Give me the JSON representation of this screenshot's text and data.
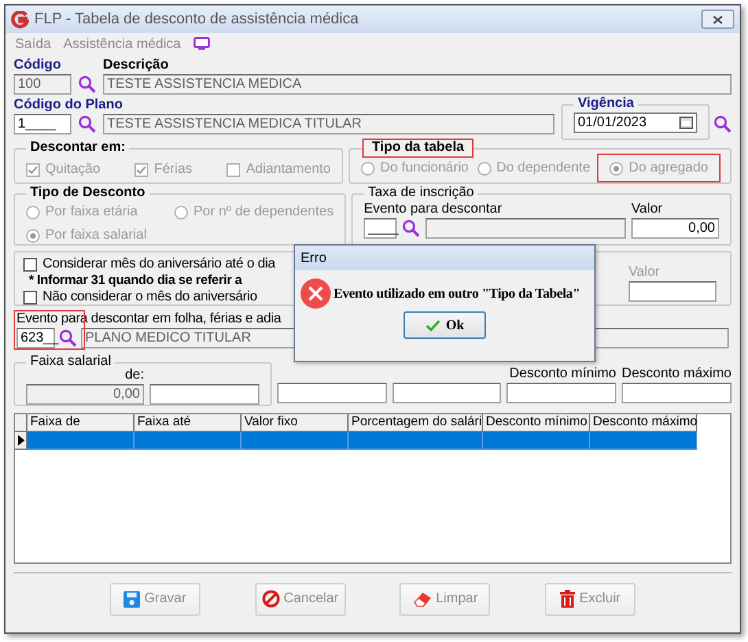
{
  "window": {
    "title": "FLP - Tabela de desconto de assistência médica"
  },
  "menu": [
    {
      "label": "Saída"
    },
    {
      "label": "Assistência médica"
    }
  ],
  "codigo": {
    "label": "Código",
    "value": "100"
  },
  "descricao": {
    "label": "Descrição",
    "value": "TESTE ASSISTENCIA MEDICA"
  },
  "codigo_plano": {
    "label": "Código do Plano",
    "value": "1____",
    "description": "TESTE ASSISTENCIA MEDICA TITULAR"
  },
  "vigencia": {
    "label": "Vigência",
    "value": "01/01/2023"
  },
  "descontar_em": {
    "title": "Descontar em:",
    "options": [
      {
        "label": "Quitação",
        "checked": true,
        "disabled": true
      },
      {
        "label": "Férias",
        "checked": true,
        "disabled": true
      },
      {
        "label": "Adiantamento",
        "checked": false,
        "disabled": true
      }
    ]
  },
  "tipo_tabela": {
    "title": "Tipo da tabela",
    "highlighted": true,
    "options": [
      {
        "label": "Do funcionário",
        "selected": false,
        "disabled": true,
        "highlighted": false
      },
      {
        "label": "Do dependente",
        "selected": false,
        "disabled": true,
        "highlighted": false
      },
      {
        "label": "Do agregado",
        "selected": true,
        "disabled": true,
        "highlighted": true
      }
    ]
  },
  "tipo_desconto": {
    "title": "Tipo de Desconto",
    "options": [
      {
        "label": "Por faixa etária",
        "selected": false,
        "disabled": true
      },
      {
        "label": "Por nº de dependentes",
        "selected": false,
        "disabled": true
      },
      {
        "label": "Por faixa salarial",
        "selected": true,
        "disabled": true
      }
    ]
  },
  "taxa_inscricao": {
    "title": "Taxa de inscrição",
    "evento_label": "Evento para descontar",
    "evento_value": "____",
    "valor_label": "Valor",
    "valor": "0,00"
  },
  "aniversario": {
    "items": [
      {
        "kind": "checkbox",
        "label": "Considerar mês do aniversário até o dia",
        "checked": false
      },
      {
        "kind": "note",
        "label": "* Informar 31 quando dia se referir a"
      },
      {
        "kind": "checkbox",
        "label": "Não considerar o mês do aniversário",
        "checked": false
      }
    ],
    "valor_label": "Valor"
  },
  "evento": {
    "label": "Evento para descontar em folha, férias e adia",
    "value": "623__",
    "description": "PLANO MEDICO TITULAR",
    "highlighted": true
  },
  "faixa_salarial": {
    "title": "Faixa salarial",
    "de_label": "de:",
    "de_value": "0,00",
    "desconto_minimo_label": "Desconto mínimo",
    "desconto_maximo_label": "Desconto máximo"
  },
  "table": {
    "columns": [
      "Faixa de",
      "Faixa até",
      "Valor fixo",
      "Porcentagem do salári",
      "Desconto mínimo",
      "Desconto máximo"
    ],
    "rows": [
      {
        "selected": true
      }
    ]
  },
  "buttons": [
    {
      "label": "Gravar",
      "kind": "save"
    },
    {
      "label": "Cancelar",
      "kind": "cancel"
    },
    {
      "label": "Limpar",
      "kind": "clear"
    },
    {
      "label": "Excluir",
      "kind": "delete"
    }
  ],
  "dialog": {
    "title": "Erro",
    "message": "Evento utilizado em outro \"Tipo da Tabela\"",
    "button": "Ok"
  }
}
